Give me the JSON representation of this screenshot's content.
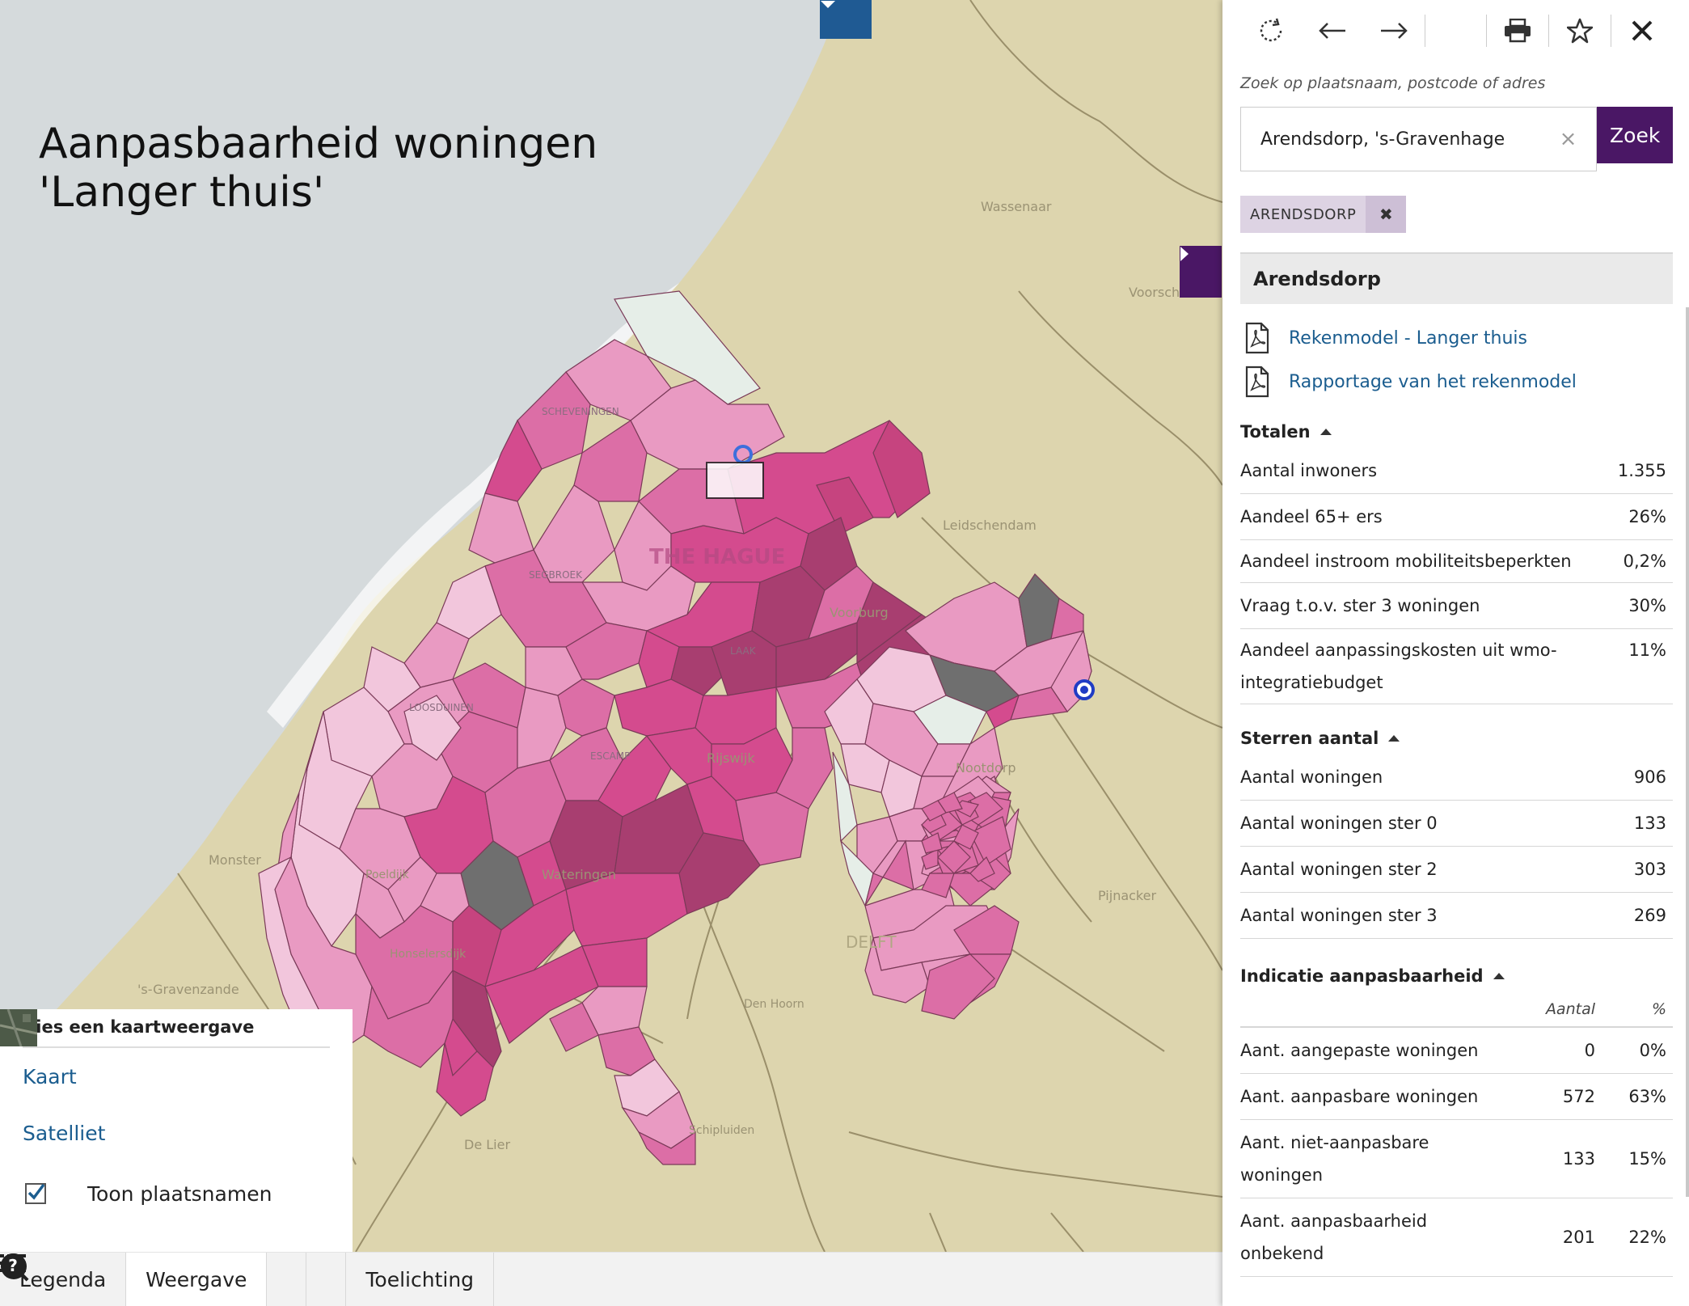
{
  "map": {
    "title_line1": "Aanpasbaarheid woningen",
    "title_line2": "'Langer thuis'",
    "place_labels": [
      "THE HAGUE",
      "Wassenaar",
      "Voorschoten",
      "Leidschendam",
      "Voorburg",
      "Rijswijk",
      "Nootdorp",
      "Pijnacker",
      "DELFT",
      "Monster",
      "Poeldijk",
      "Wateringen",
      "Honselersdijk",
      "'s-Gravenzande",
      "Den Hoorn",
      "De Lier",
      "Schipluiden",
      "SCHEVENINGEN",
      "SEGBROEK",
      "LOOSDUINEN",
      "ESCAMP",
      "LAAK"
    ],
    "colors": {
      "sea": "#d5dadc",
      "land": "#ddd5ae",
      "pink_lightest": "#f2c6dc",
      "pink_light": "#e99ac2",
      "pink_mid": "#dc6ea6",
      "pink_strong": "#d44b8e",
      "pink_dark": "#a83e70",
      "gray": "#6f6f6f",
      "accent_blue": "#1f5a93",
      "accent_purple": "#4a1765"
    }
  },
  "view_box": {
    "heading": "Kies een kaartweergave",
    "options": [
      "Kaart",
      "Satelliet"
    ],
    "checkbox_label": "Toon plaatsnamen",
    "checkbox_checked": true
  },
  "toolbar": {
    "legenda": "Legenda",
    "weergave": "Weergave",
    "toelichting": "Toelichting"
  },
  "panel": {
    "search_label": "Zoek op plaatsnaam, postcode of adres",
    "search_value": "Arendsdorp, 's-Gravenhage",
    "search_button": "Zoek",
    "chip": "ARENDSDORP",
    "area_title": "Arendsdorp",
    "links": [
      "Rekenmodel - Langer thuis",
      "Rapportage van het rekenmodel"
    ],
    "totalen": {
      "heading": "Totalen",
      "rows": [
        {
          "label": "Aantal inwoners",
          "value": "1.355"
        },
        {
          "label": "Aandeel 65+ ers",
          "value": "26%"
        },
        {
          "label": "Aandeel instroom mobiliteitsbeperkten",
          "value": "0,2%"
        },
        {
          "label": "Vraag t.o.v. ster 3 woningen",
          "value": "30%"
        },
        {
          "label": "Aandeel aanpassingskosten uit wmo-integratiebudget",
          "value": "11%"
        }
      ]
    },
    "sterren": {
      "heading": "Sterren aantal",
      "rows": [
        {
          "label": "Aantal woningen",
          "value": "906"
        },
        {
          "label": "Aantal woningen ster 0",
          "value": "133"
        },
        {
          "label": "Aantal woningen ster 2",
          "value": "303"
        },
        {
          "label": "Aantal woningen ster 3",
          "value": "269"
        }
      ]
    },
    "indicatie": {
      "heading": "Indicatie aanpasbaarheid",
      "col_aantal": "Aantal",
      "col_pct": "%",
      "rows": [
        {
          "label": "Aant. aangepaste woningen",
          "aantal": "0",
          "pct": "0%"
        },
        {
          "label": "Aant. aanpasbare woningen",
          "aantal": "572",
          "pct": "63%"
        },
        {
          "label": "Aant. niet-aanpasbare woningen",
          "aantal": "133",
          "pct": "15%"
        },
        {
          "label": "Aant. aanpasbaarheid onbekend",
          "aantal": "201",
          "pct": "22%"
        }
      ]
    }
  }
}
